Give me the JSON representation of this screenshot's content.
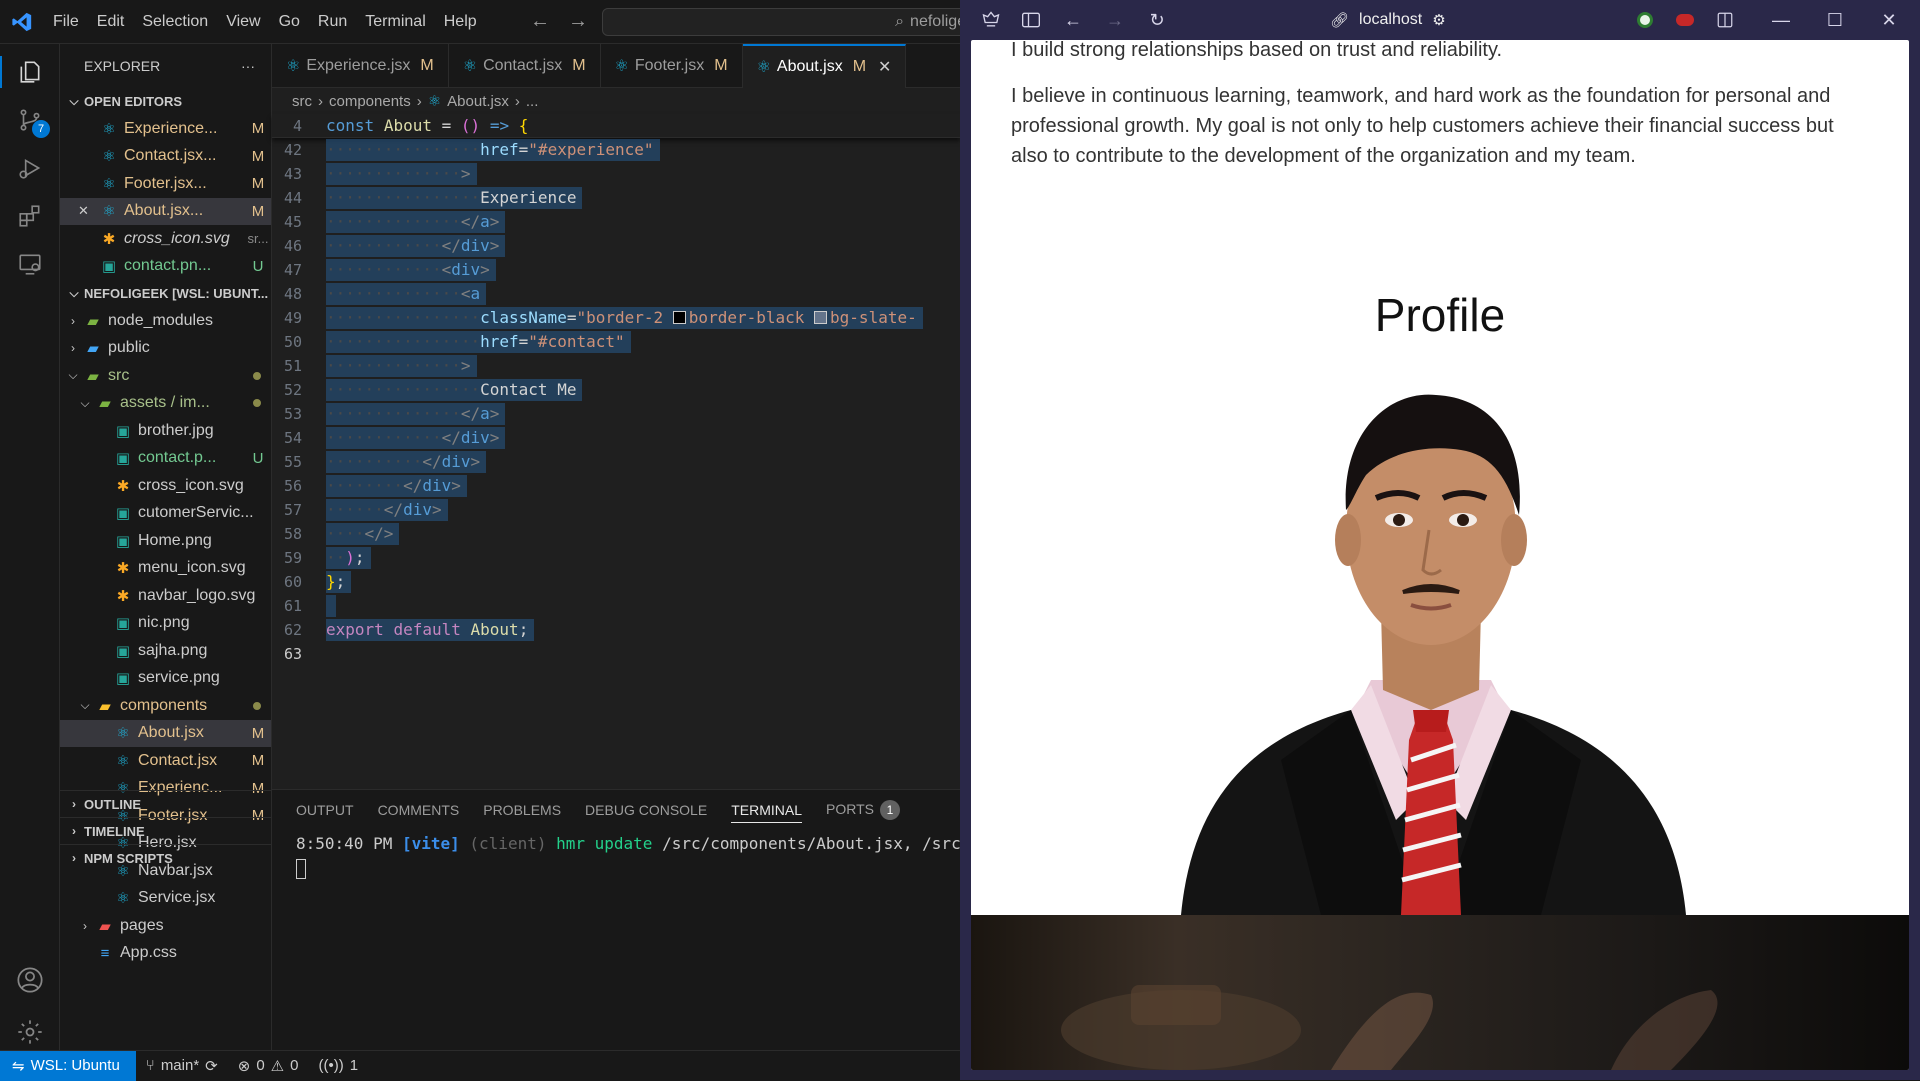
{
  "vscode": {
    "menu": [
      "File",
      "Edit",
      "Selection",
      "View",
      "Go",
      "Run",
      "Terminal",
      "Help"
    ],
    "command_center": "nefoligee",
    "scm_badge": "7",
    "explorer": {
      "title": "EXPLORER",
      "more": "···",
      "open_editors_title": "OPEN EDITORS",
      "open_editors": [
        {
          "name": "Experience...",
          "status": "M",
          "icon": "react-icon"
        },
        {
          "name": "Contact.jsx...",
          "status": "M",
          "icon": "react-icon"
        },
        {
          "name": "Footer.jsx...",
          "status": "M",
          "icon": "react-icon"
        },
        {
          "name": "About.jsx...",
          "status": "M",
          "icon": "react-icon"
        },
        {
          "name": "cross_icon.svg",
          "status": "sr...",
          "icon": "svg-icon"
        },
        {
          "name": "contact.pn...",
          "status": "U",
          "icon": "image-icon"
        }
      ],
      "workspace_title": "NEFOLIGEEK [WSL: UBUNT...",
      "tree": [
        {
          "name": "node_modules",
          "depth": 1,
          "type": "folder",
          "open": false
        },
        {
          "name": "public",
          "depth": 1,
          "type": "folder",
          "open": false
        },
        {
          "name": "src",
          "depth": 1,
          "type": "folder",
          "open": true
        },
        {
          "name": "assets / im...",
          "depth": 2,
          "type": "folder",
          "open": true
        },
        {
          "name": "brother.jpg",
          "depth": 3,
          "type": "image"
        },
        {
          "name": "contact.p...",
          "depth": 3,
          "type": "image",
          "status": "U"
        },
        {
          "name": "cross_icon.svg",
          "depth": 3,
          "type": "svg"
        },
        {
          "name": "cutomerServic...",
          "depth": 3,
          "type": "image"
        },
        {
          "name": "Home.png",
          "depth": 3,
          "type": "image"
        },
        {
          "name": "menu_icon.svg",
          "depth": 3,
          "type": "svg"
        },
        {
          "name": "navbar_logo.svg",
          "depth": 3,
          "type": "svg"
        },
        {
          "name": "nic.png",
          "depth": 3,
          "type": "image"
        },
        {
          "name": "sajha.png",
          "depth": 3,
          "type": "image"
        },
        {
          "name": "service.png",
          "depth": 3,
          "type": "image"
        },
        {
          "name": "components",
          "depth": 2,
          "type": "folder",
          "open": true
        },
        {
          "name": "About.jsx",
          "depth": 3,
          "type": "react",
          "status": "M"
        },
        {
          "name": "Contact.jsx",
          "depth": 3,
          "type": "react",
          "status": "M"
        },
        {
          "name": "Experienc...",
          "depth": 3,
          "type": "react",
          "status": "M"
        },
        {
          "name": "Footer.jsx",
          "depth": 3,
          "type": "react",
          "status": "M"
        },
        {
          "name": "Hero.jsx",
          "depth": 3,
          "type": "react"
        },
        {
          "name": "Navbar.jsx",
          "depth": 3,
          "type": "react"
        },
        {
          "name": "Service.jsx",
          "depth": 3,
          "type": "react"
        },
        {
          "name": "pages",
          "depth": 2,
          "type": "folder",
          "open": false
        },
        {
          "name": "App.css",
          "depth": 2,
          "type": "css"
        }
      ],
      "outline": "OUTLINE",
      "timeline": "TIMELINE",
      "npm_scripts": "NPM SCRIPTS"
    },
    "tabs": [
      {
        "name": "Experience.jsx",
        "status": "M"
      },
      {
        "name": "Contact.jsx",
        "status": "M"
      },
      {
        "name": "Footer.jsx",
        "status": "M"
      },
      {
        "name": "About.jsx",
        "status": "M",
        "active": true
      }
    ],
    "breadcrumb": [
      "src",
      "components",
      "About.jsx",
      "..."
    ],
    "sticky_line": {
      "num": "4",
      "text": "const About = () => {"
    },
    "code_lines": [
      {
        "num": "42",
        "indent": 16,
        "html": "<span class='at'>href</span><span class='tx'>=</span><span class='str'>\"#experience\"</span>"
      },
      {
        "num": "43",
        "indent": 14,
        "html": "<span class='tg'>&gt;</span>"
      },
      {
        "num": "44",
        "indent": 16,
        "html": "<span class='tx'>Experience</span>"
      },
      {
        "num": "45",
        "indent": 14,
        "html": "<span class='tg'>&lt;/</span><span class='kw2'>a</span><span class='tg'>&gt;</span>"
      },
      {
        "num": "46",
        "indent": 12,
        "html": "<span class='tg'>&lt;/</span><span class='kw2'>div</span><span class='tg'>&gt;</span>"
      },
      {
        "num": "47",
        "indent": 12,
        "html": "<span class='tg'>&lt;</span><span class='kw2'>div</span><span class='tg'>&gt;</span>"
      },
      {
        "num": "48",
        "indent": 14,
        "html": "<span class='tg'>&lt;</span><span class='kw2'>a</span>"
      },
      {
        "num": "49",
        "indent": 16,
        "html": "<span class='at'>className</span><span class='tx'>=</span><span class='str'>\"border-2 </span><span class='sw' style='background:#000'></span><span class='str'>border-black </span><span class='sw' style='background:#64748b'></span><span class='str'>bg-slate-</span>"
      },
      {
        "num": "50",
        "indent": 16,
        "html": "<span class='at'>href</span><span class='tx'>=</span><span class='str'>\"#contact\"</span>"
      },
      {
        "num": "51",
        "indent": 14,
        "html": "<span class='tg'>&gt;</span>"
      },
      {
        "num": "52",
        "indent": 16,
        "html": "<span class='tx'>Contact Me</span>"
      },
      {
        "num": "53",
        "indent": 14,
        "html": "<span class='tg'>&lt;/</span><span class='kw2'>a</span><span class='tg'>&gt;</span>"
      },
      {
        "num": "54",
        "indent": 12,
        "html": "<span class='tg'>&lt;/</span><span class='kw2'>div</span><span class='tg'>&gt;</span>"
      },
      {
        "num": "55",
        "indent": 10,
        "html": "<span class='tg'>&lt;/</span><span class='kw2'>div</span><span class='tg'>&gt;</span>"
      },
      {
        "num": "56",
        "indent": 8,
        "html": "<span class='tg'>&lt;/</span><span class='kw2'>div</span><span class='tg'>&gt;</span>"
      },
      {
        "num": "57",
        "indent": 6,
        "html": "<span class='tg'>&lt;/</span><span class='kw2'>div</span><span class='tg'>&gt;</span>"
      },
      {
        "num": "58",
        "indent": 4,
        "html": "<span class='tg'>&lt;/&gt;</span>"
      },
      {
        "num": "59",
        "indent": 2,
        "html": "<span class='br2'>)</span><span class='tx'>;</span>"
      },
      {
        "num": "60",
        "indent": 0,
        "html": "<span class='br'>}</span><span class='tx'>;</span>"
      },
      {
        "num": "61",
        "indent": 0,
        "html": ""
      },
      {
        "num": "62",
        "indent": 0,
        "html": "<span class='kw'>export</span> <span class='kw'>default</span> <span class='fn'>About</span><span class='tx'>;</span>"
      },
      {
        "num": "63",
        "indent": 0,
        "html": "",
        "current": true
      }
    ],
    "panel_tabs": [
      "OUTPUT",
      "COMMENTS",
      "PROBLEMS",
      "DEBUG CONSOLE",
      "TERMINAL",
      "PORTS"
    ],
    "active_panel": "TERMINAL",
    "ports_badge": "1",
    "terminal": {
      "time": "8:50:40 PM",
      "tag": "[vite]",
      "client": "(client)",
      "action": "hmr update",
      "paths": "/src/components/About.jsx, /src/inde"
    },
    "status": {
      "remote": "WSL: Ubuntu",
      "branch": "main*",
      "errors": "0",
      "warnings": "0",
      "ports": "1"
    }
  },
  "browser": {
    "url": "localhost",
    "page": {
      "para1_tail": "I build strong relationships based on trust and reliability.",
      "para2": "I believe in continuous learning, teamwork, and hard work as the foundation for personal and professional growth. My goal is not only to help customers achieve their financial success but also to contribute to the development of the organization and my team.",
      "profile_heading": "Profile"
    }
  }
}
